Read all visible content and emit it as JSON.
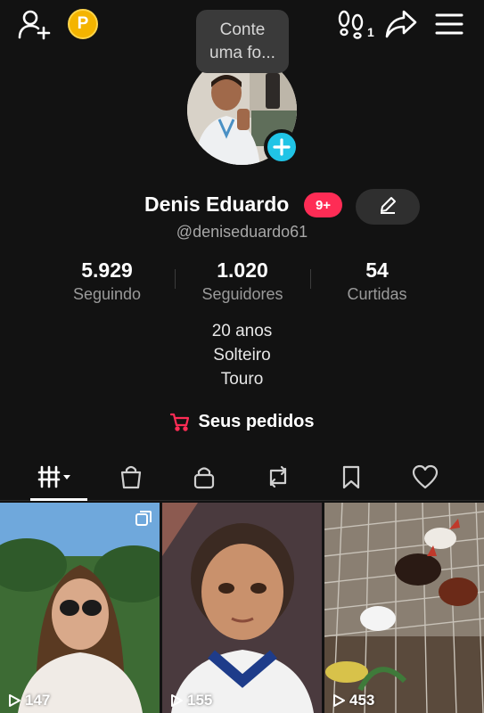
{
  "topbar": {
    "add_friend_icon": "person-add-icon",
    "coin_icon": "coin-icon",
    "coin_letter": "P",
    "profile_views_icon": "footprints-icon",
    "profile_views_count": "1",
    "share_icon": "share-icon",
    "menu_icon": "hamburger-menu-icon"
  },
  "story_bubble": {
    "line1": "Conte",
    "line2": "uma fo..."
  },
  "profile": {
    "name": "Denis Eduardo",
    "notification_badge": "9+",
    "handle": "@deniseduardo61",
    "edit_icon": "pencil-icon",
    "add_icon": "plus-icon"
  },
  "stats": [
    {
      "value": "5.929",
      "label": "Seguindo"
    },
    {
      "value": "1.020",
      "label": "Seguidores"
    },
    {
      "value": "54",
      "label": "Curtidas"
    }
  ],
  "bio": [
    "20 anos",
    "Solteiro",
    "Touro"
  ],
  "orders": {
    "label": "Seus pedidos",
    "icon": "shopping-cart-icon",
    "accent": "#fe2c55"
  },
  "tabs": [
    {
      "name": "videos-grid-icon",
      "active": true
    },
    {
      "name": "shopping-bag-icon",
      "active": false
    },
    {
      "name": "lock-icon",
      "active": false
    },
    {
      "name": "repost-icon",
      "active": false
    },
    {
      "name": "bookmark-icon",
      "active": false
    },
    {
      "name": "heart-icon",
      "active": false
    }
  ],
  "videos": [
    {
      "views": "147"
    },
    {
      "views": "155"
    },
    {
      "views": "453"
    }
  ],
  "colors": {
    "background": "#121212",
    "accent_red": "#fe2c55",
    "accent_cyan": "#20c4e6",
    "coin": "#f4b400"
  }
}
